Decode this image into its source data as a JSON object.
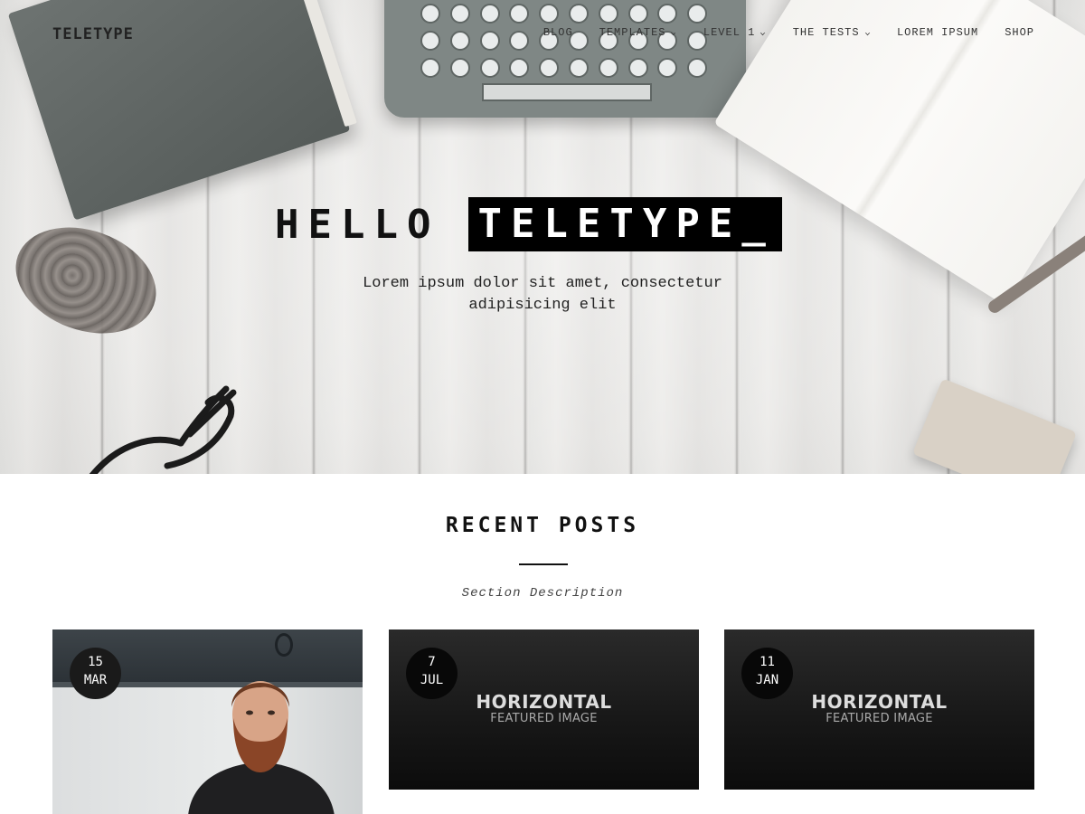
{
  "header": {
    "logo": "TELETYPE",
    "nav": [
      {
        "label": "BLOG",
        "has_dropdown": false
      },
      {
        "label": "TEMPLATES",
        "has_dropdown": true
      },
      {
        "label": "LEVEL 1",
        "has_dropdown": true
      },
      {
        "label": "THE TESTS",
        "has_dropdown": true
      },
      {
        "label": "LOREM IPSUM",
        "has_dropdown": false
      },
      {
        "label": "SHOP",
        "has_dropdown": false
      }
    ],
    "dropdown_icon": "chevron-down-icon"
  },
  "hero": {
    "title_plain": "HELLO",
    "title_boxed": "TELETYPE_",
    "subtitle_line1": "Lorem ipsum dolor sit amet, consectetur",
    "subtitle_line2": "adipisicing elit"
  },
  "recent_posts": {
    "title": "RECENT POSTS",
    "description": "Section Description",
    "posts": [
      {
        "day": "15",
        "month": "MAR",
        "image": "photo-bearded-man"
      },
      {
        "day": "7",
        "month": "JUL",
        "image": "placeholder",
        "placeholder_title": "HORIZONTAL",
        "placeholder_sub": "FEATURED IMAGE"
      },
      {
        "day": "11",
        "month": "JAN",
        "image": "placeholder",
        "placeholder_title": "HORIZONTAL",
        "placeholder_sub": "FEATURED IMAGE"
      }
    ]
  },
  "colors": {
    "text": "#111111",
    "badge_bg": "#1a1a1a",
    "placeholder_bg": "#1c1c1c",
    "hero_bg": "#e8e7e5"
  }
}
